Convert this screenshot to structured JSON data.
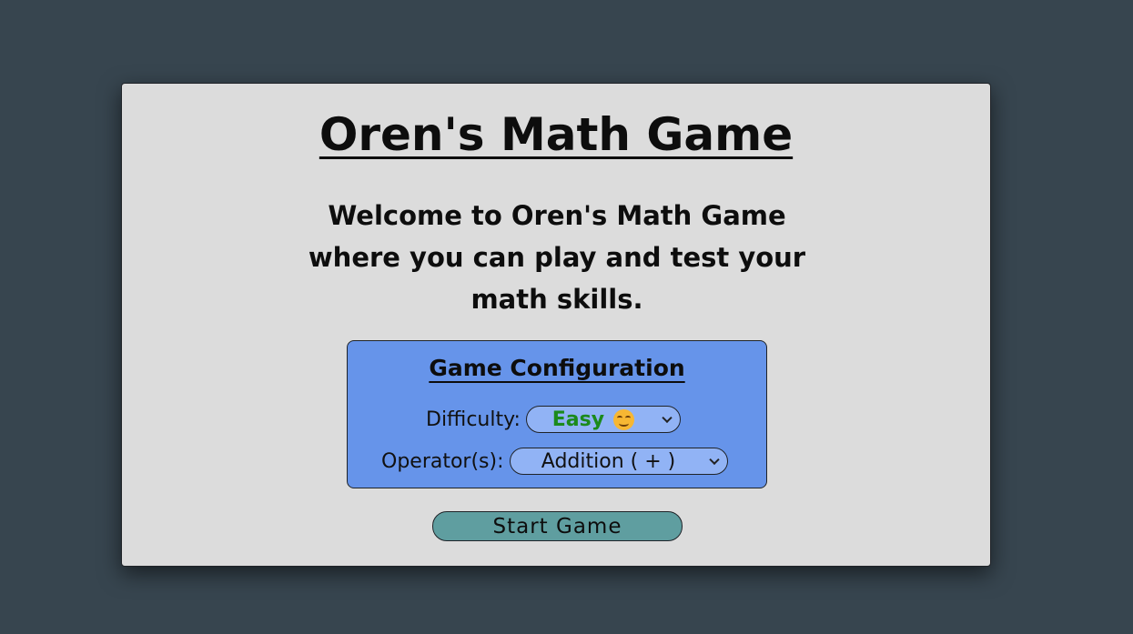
{
  "page": {
    "title": "Oren's Math Game",
    "welcome": "Welcome to Oren's Math Game where you can play and test your math skills."
  },
  "config": {
    "title": "Game Configuration",
    "difficulty_label": "Difficulty:",
    "difficulty_value": "Easy",
    "difficulty_icon": "smiling-face-icon",
    "operator_label": "Operator(s):",
    "operator_value": "Addition ( + )"
  },
  "actions": {
    "start_label": "Start Game"
  },
  "colors": {
    "background": "#37454f",
    "card": "#dcdcdc",
    "config_panel": "#6694ea",
    "select_fill": "#91b3f5",
    "easy_text": "#1b8a1b",
    "start_button": "#5f9ea0"
  }
}
